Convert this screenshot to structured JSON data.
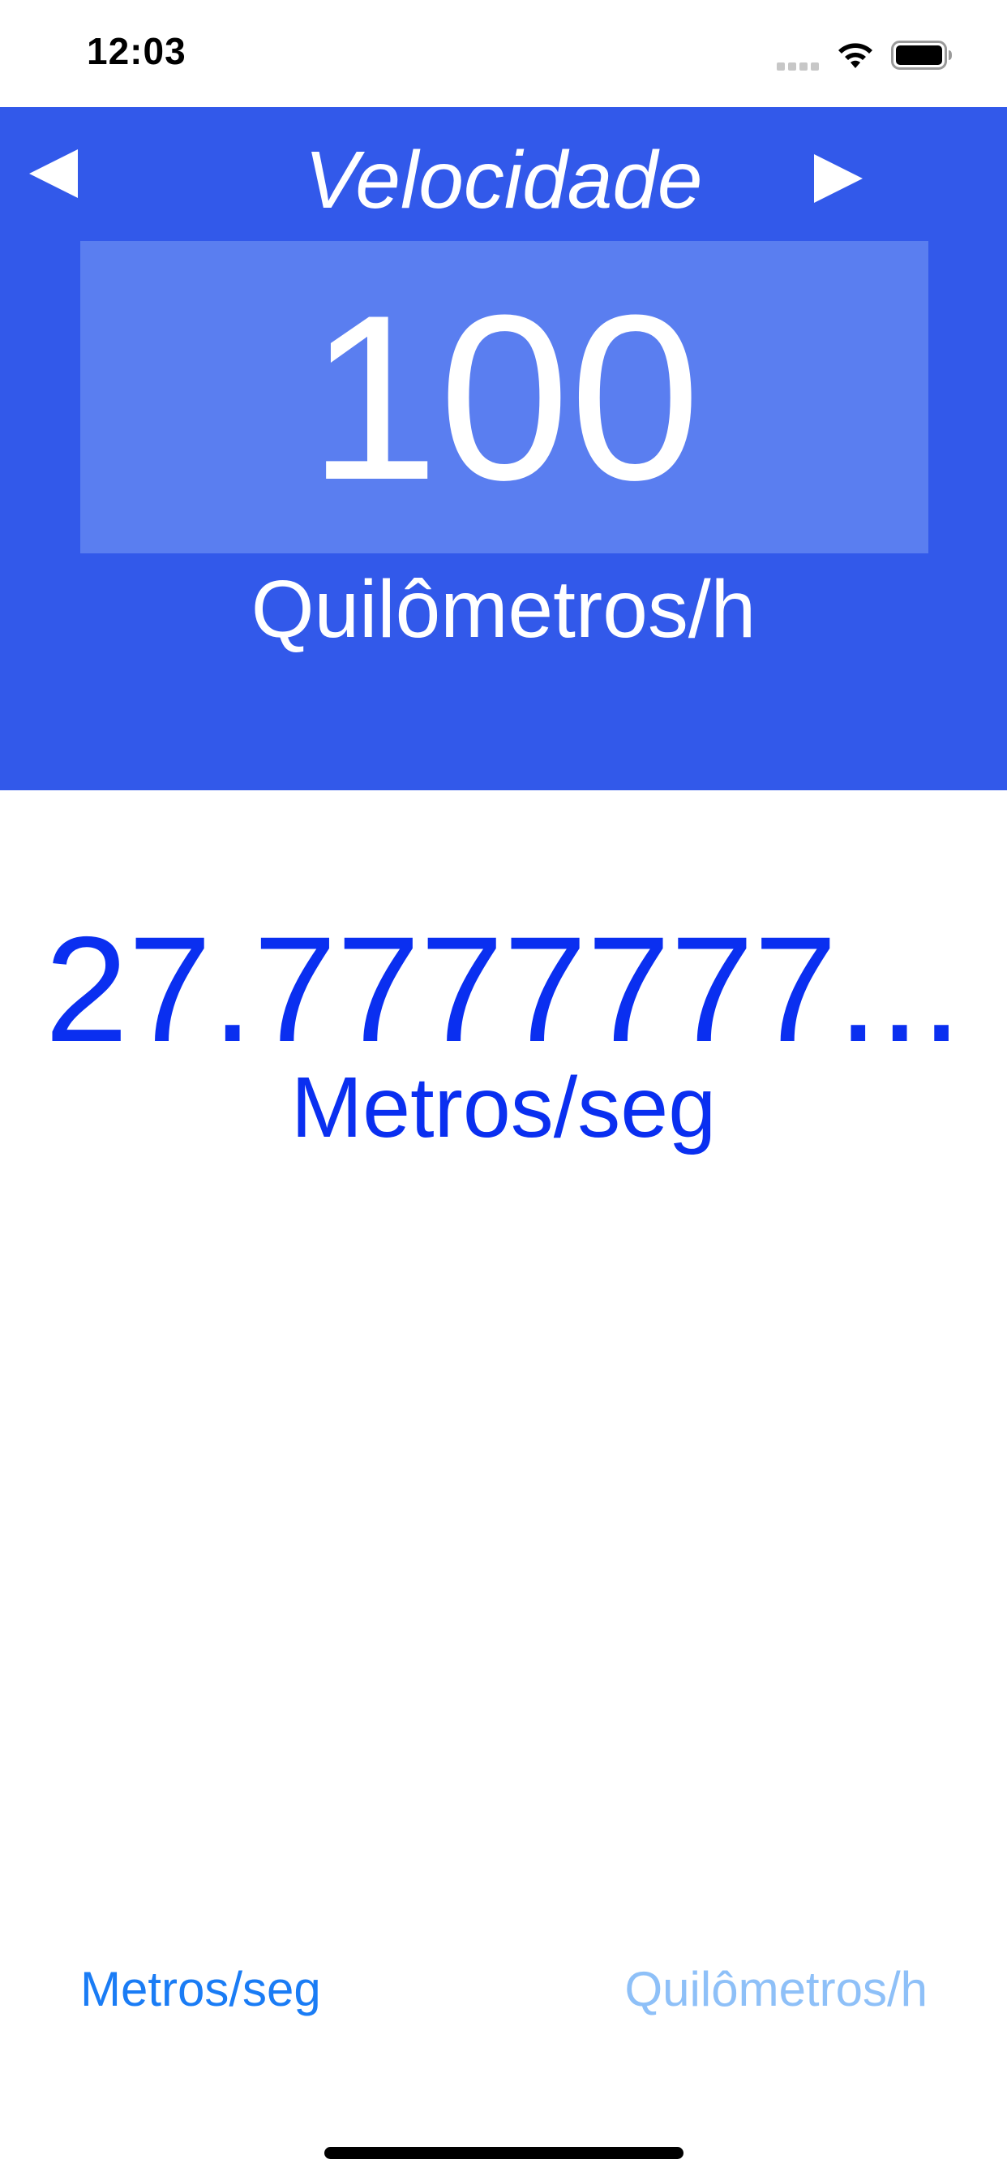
{
  "status_bar": {
    "time": "12:03"
  },
  "header": {
    "title": "Velocidade",
    "input_value": "100",
    "input_unit": "Quilômetros/h",
    "prev_icon": "left-triangle-icon",
    "next_icon": "right-triangle-icon"
  },
  "result": {
    "value": "27.7777777...",
    "unit": "Metros/seg"
  },
  "unit_options": {
    "left_label": "Metros/seg",
    "right_label": "Quilômetros/h"
  },
  "colors": {
    "header_background": "#3259ea",
    "value_box_background": "#5a7ef0",
    "result_text": "#0a2ff0",
    "option_active": "#1a7cf5",
    "option_inactive": "#8ec0f8"
  }
}
